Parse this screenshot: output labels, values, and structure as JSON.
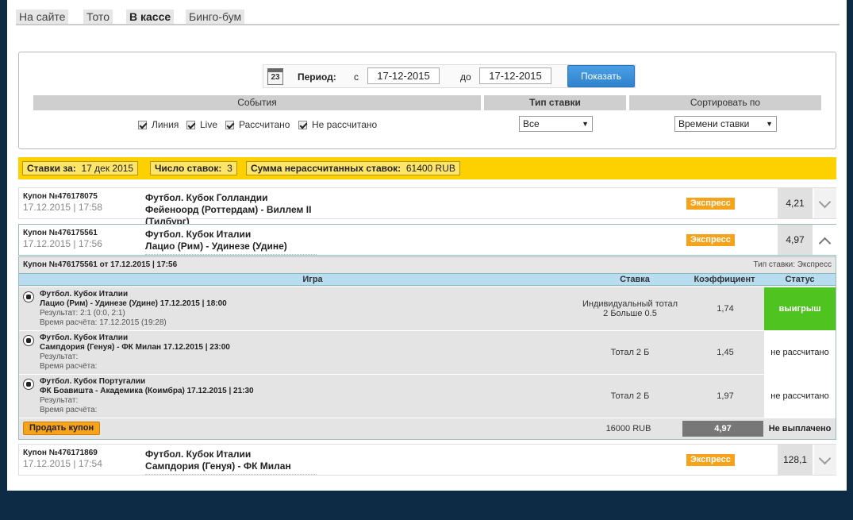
{
  "tabs": [
    "На сайте",
    "Тото",
    "В кассе",
    "Бинго-бум"
  ],
  "filter": {
    "period_label": "Период:",
    "calendar_day": "23",
    "from_label": "с",
    "from_date": "17-12-2015",
    "to_label": "до",
    "to_date": "17-12-2015",
    "show_button": "Показать",
    "events_header": "События",
    "bet_type_header": "Тип ставки",
    "sort_header": "Сортировать по",
    "checkboxes": [
      "Линия",
      "Live",
      "Рассчитано",
      "Не рассчитано"
    ],
    "bet_type_value": "Все",
    "sort_value": "Времени ставки"
  },
  "summary": {
    "bets_for_label": "Ставки за:",
    "bets_for_value": "17 дек 2015",
    "count_label": "Число ставок:",
    "count_value": "3",
    "sum_label": "Сумма нерассчитанных ставок:",
    "sum_value": "61400 RUB"
  },
  "coupons": [
    {
      "number": "Купон №476178075",
      "date": "17.12.2015 | 17:58",
      "league": "Футбол. Кубок Голландии",
      "match": "Фейеноорд (Роттердам) - Виллем II (Тилбург)",
      "type": "Экспресс",
      "coef": "4,21"
    },
    {
      "number": "Купон №476175561",
      "date": "17.12.2015 | 17:56",
      "league": "Футбол. Кубок Италии",
      "match": "Лацио (Рим) - Удинезе (Удине)",
      "type": "Экспресс",
      "coef": "4,97"
    },
    {
      "number": "Купон №476171869",
      "date": "17.12.2015 | 17:54",
      "league": "Футбол. Кубок Италии",
      "match": "Сампдория (Генуя) - ФК Милан",
      "type": "Экспресс",
      "coef": "128,1"
    }
  ],
  "detail": {
    "title": "Купон №476175561 от 17.12.2015 | 17:56",
    "bet_type": "Тип ставки: Экспресс",
    "columns": [
      "Игра",
      "Ставка",
      "Коэффициент",
      "Статус"
    ],
    "rows": [
      {
        "league": "Футбол. Кубок Италии",
        "match": "Лацио (Рим) - Удинезе (Удине) 17.12.2015 | 18:00",
        "result": "Результат: 2:1 (0:0, 2:1)",
        "calc_time": "Время расчёта: 17.12.2015 (19:28)",
        "stake_line1": "Индивидуальный тотал",
        "stake_line2": "2 Больше 0.5",
        "coef": "1,74",
        "status": "выигрыш"
      },
      {
        "league": "Футбол. Кубок Италии",
        "match": "Сампдория (Генуя) - ФК Милан 17.12.2015 | 23:00",
        "result": "Результат:",
        "calc_time": "Время расчёта:",
        "stake_line1": "Тотал 2 Б",
        "coef": "1,45",
        "status": "не рассчитано"
      },
      {
        "league": "Футбол. Кубок Португалии",
        "match": "ФК Боавишта - Академика (Коимбра) 17.12.2015 | 21:30",
        "result": "Результат:",
        "calc_time": "Время расчёта:",
        "stake_line1": "Тотал 2 Б",
        "coef": "1,97",
        "status": "не рассчитано"
      }
    ],
    "sell_button": "Продать купон",
    "total_sum": "16000 RUB",
    "total_coef": "4,97",
    "total_status": "Не выплачено"
  },
  "colors": {
    "background": "#0d2b45",
    "summary_bar": "#fdd000",
    "express_badge": "#f7a21b",
    "win_status": "#4fc31f",
    "show_button": "#2f82cf"
  }
}
